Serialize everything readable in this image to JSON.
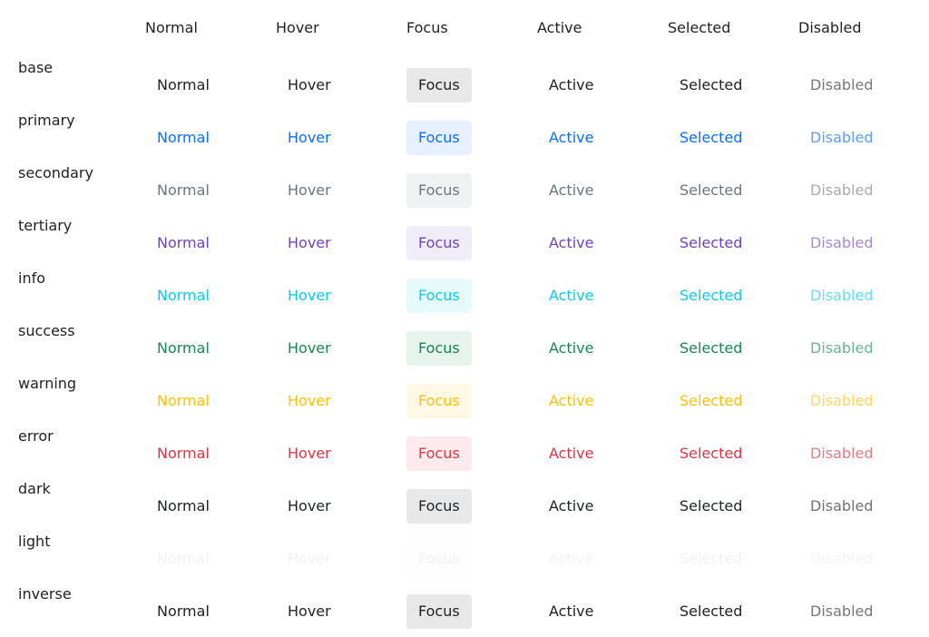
{
  "columns": [
    {
      "key": "normal",
      "label": "Normal"
    },
    {
      "key": "hover",
      "label": "Hover"
    },
    {
      "key": "focus",
      "label": "Focus"
    },
    {
      "key": "active",
      "label": "Active"
    },
    {
      "key": "selected",
      "label": "Selected"
    },
    {
      "key": "disabled",
      "label": "Disabled"
    }
  ],
  "rows": [
    {
      "name": "base",
      "text_color": "#222222",
      "focus_bg": "#e8e8e8",
      "disabled_color": "#777777"
    },
    {
      "name": "primary",
      "text_color": "#0d6efd",
      "focus_bg": "#e7f0ff",
      "disabled_color": "#5c9df5"
    },
    {
      "name": "secondary",
      "text_color": "#6c757d",
      "focus_bg": "#f0f1f2",
      "disabled_color": "#a7abb0"
    },
    {
      "name": "tertiary",
      "text_color": "#6f42c1",
      "focus_bg": "#f0ecf9",
      "disabled_color": "#a589d8"
    },
    {
      "name": "info",
      "text_color": "#0dcaf0",
      "focus_bg": "#e6fafd",
      "disabled_color": "#67dcf4"
    },
    {
      "name": "success",
      "text_color": "#198754",
      "focus_bg": "#e7f3ed",
      "disabled_color": "#6ab390"
    },
    {
      "name": "warning",
      "text_color": "#ffc107",
      "focus_bg": "#fff8e5",
      "disabled_color": "#ffd764"
    },
    {
      "name": "error",
      "text_color": "#dc3545",
      "focus_bg": "#fceaec",
      "disabled_color": "#e77a85"
    },
    {
      "name": "dark",
      "text_color": "#212529",
      "focus_bg": "#e8e8e8",
      "disabled_color": "#6f7173"
    },
    {
      "name": "light",
      "text_color": "#f1f2f3",
      "focus_bg": "#fdfdfd",
      "disabled_color": "#f4f4f5"
    },
    {
      "name": "inverse",
      "text_color": "#222222",
      "focus_bg": "#e8e8e8",
      "disabled_color": "#777777"
    }
  ]
}
